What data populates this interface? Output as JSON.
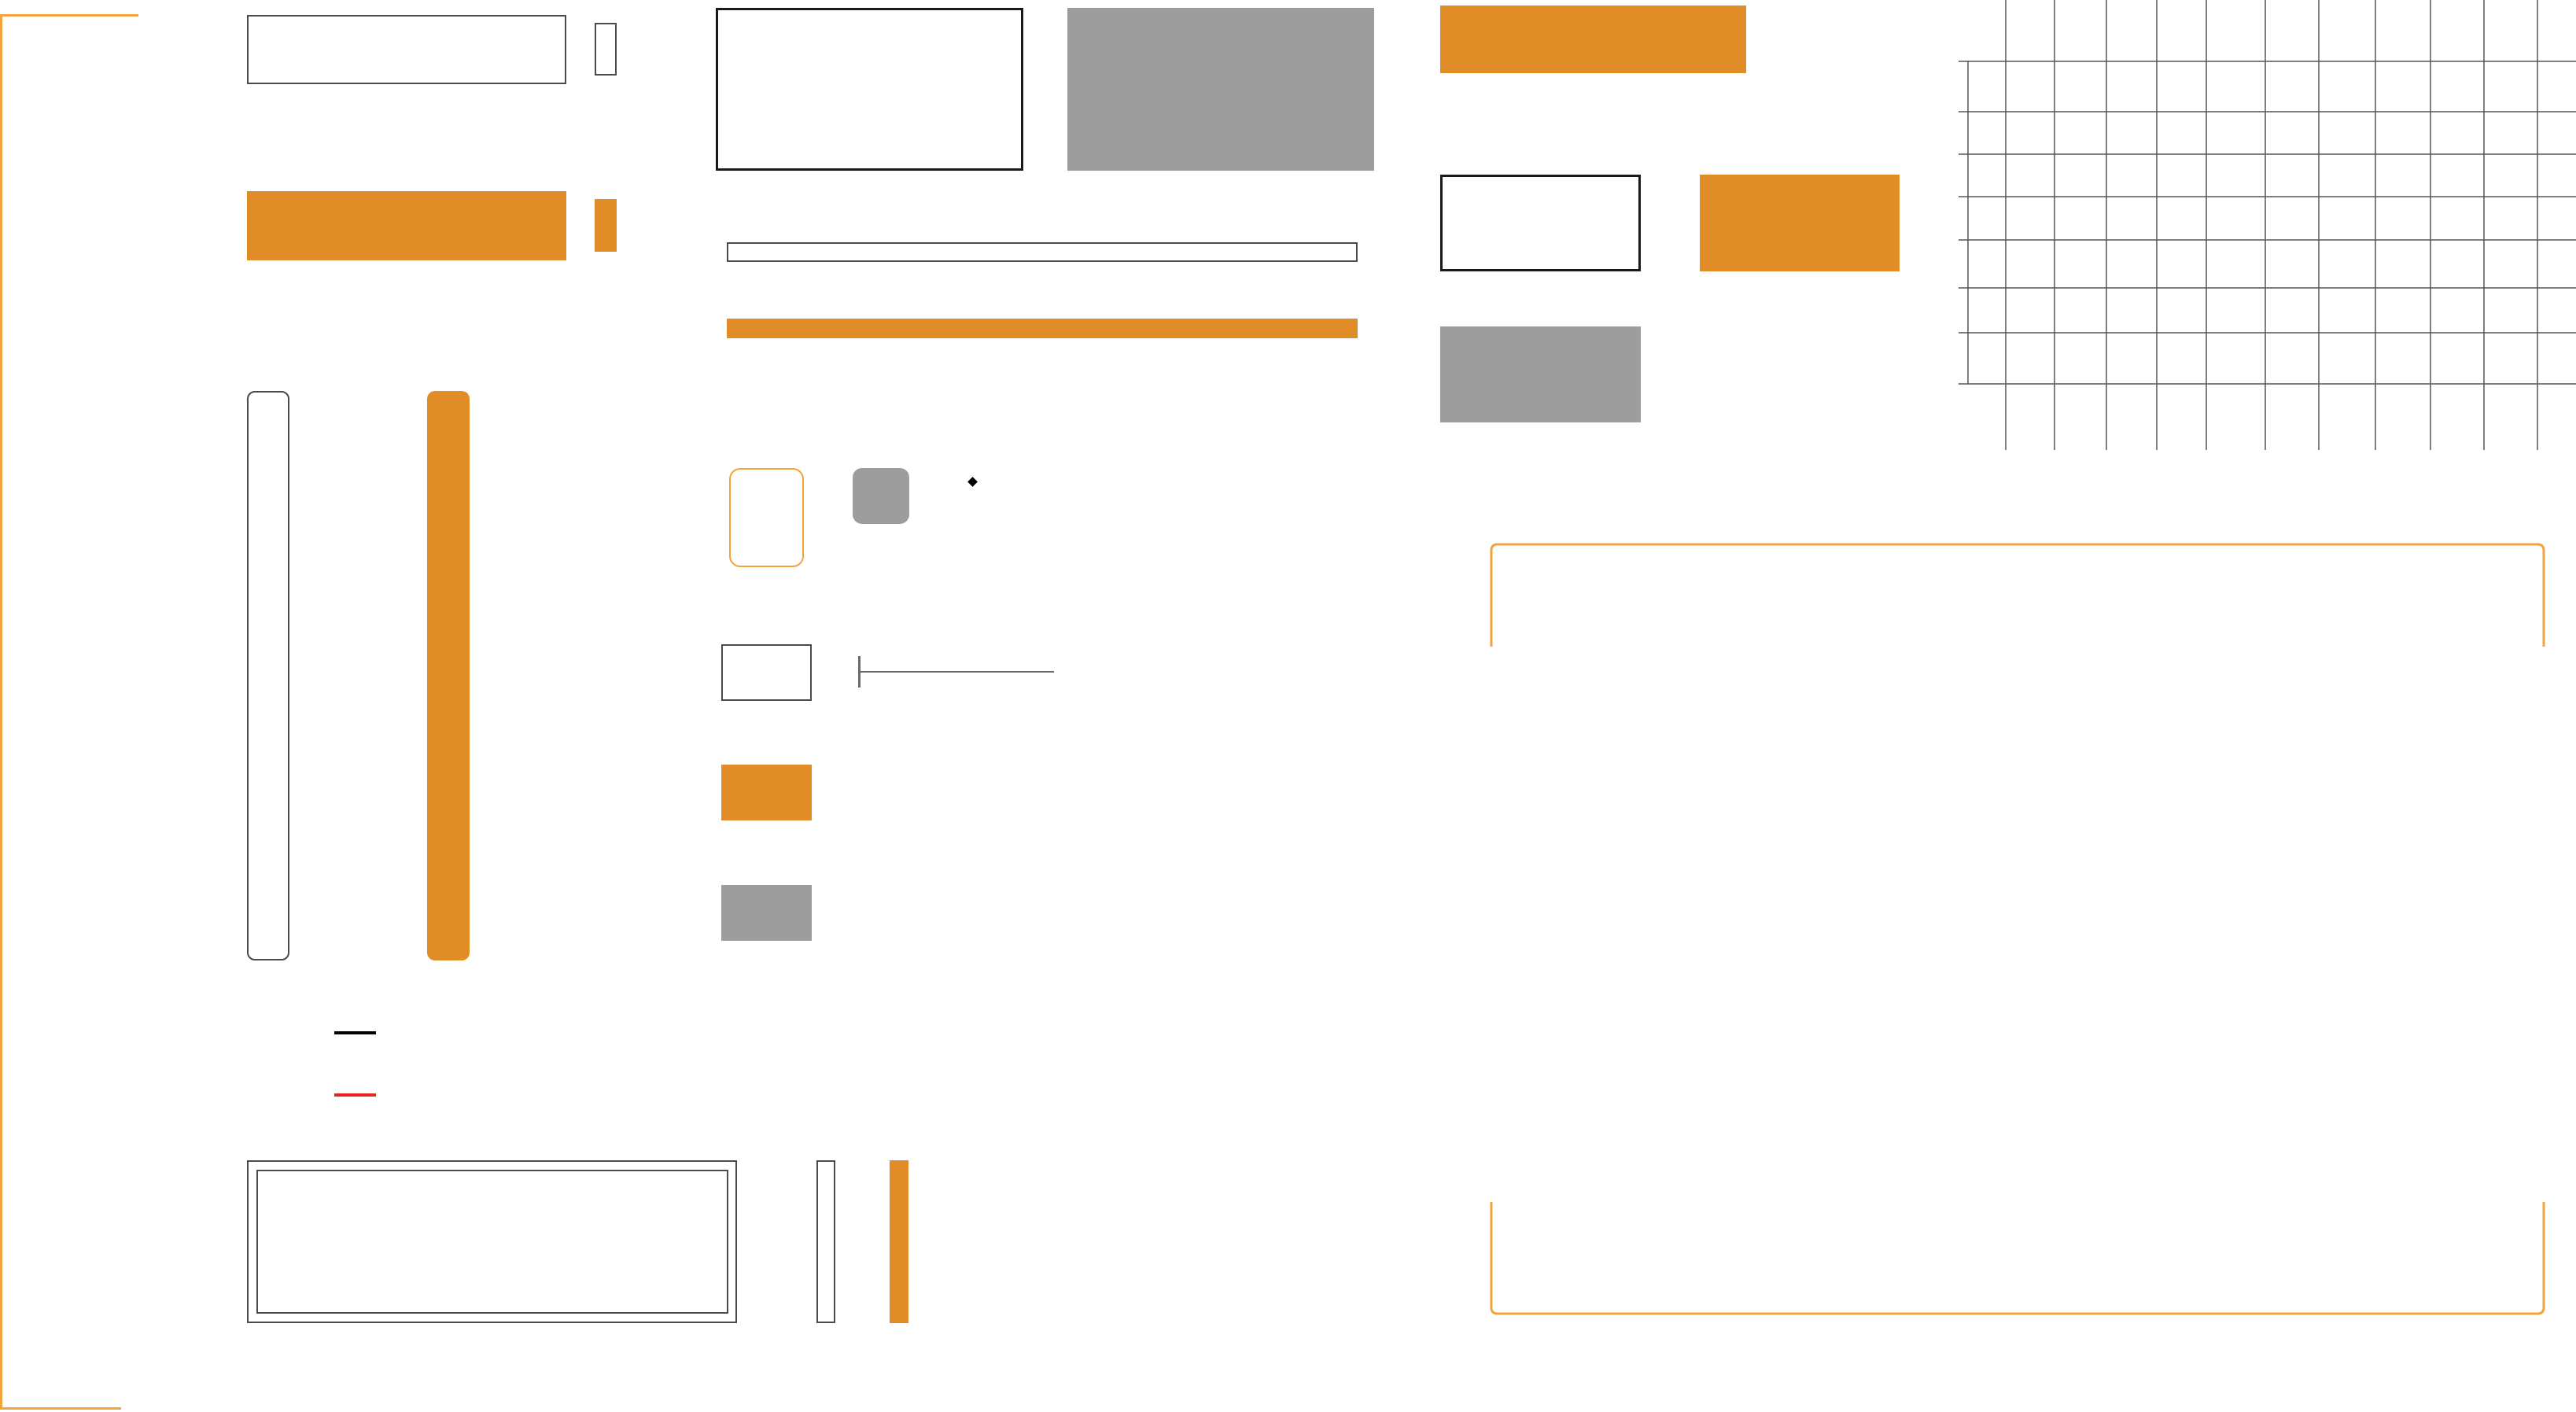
{
  "palette": {
    "accent": "#e08c27",
    "accent_light": "#f0a43a",
    "gray": "#9d9d9d",
    "outline": "#4a4a4a",
    "black": "#000000",
    "red": "#e8231f",
    "grid_line": "#555555"
  },
  "legend": {
    "lines": [
      {
        "name": "black-line-sample",
        "color": "#000000"
      },
      {
        "name": "red-line-sample",
        "color": "#e8231f"
      }
    ]
  },
  "slider": {
    "level": 0.0
  },
  "grid": {
    "columns": 12,
    "rows": 8
  }
}
